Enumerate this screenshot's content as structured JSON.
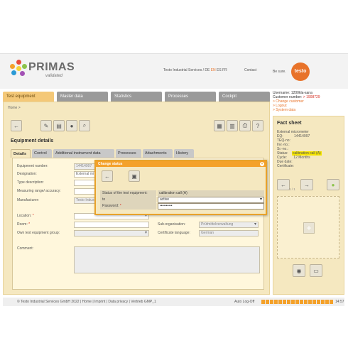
{
  "header": {
    "logo_text": "PRIMAS",
    "logo_sub": "validated",
    "company": "Testo Industrial Services / ",
    "languages": [
      "DE",
      "EN",
      "ES",
      "FR"
    ],
    "active_language": "EN",
    "contact": "Contact",
    "besure": "Be sure.",
    "testo": "testo"
  },
  "nav": {
    "tabs": [
      "Test equipment",
      "Master data",
      "Statistics",
      "Processes",
      "Cockpit"
    ],
    "active_tab": "Test equipment"
  },
  "user": {
    "username_label": "Username: 1200kla-sana",
    "customer_label": "Customer number: ",
    "customer_number": "> 1908729",
    "change_customer": "> Change customer",
    "logout": "> Logout",
    "system_data": "> System data"
  },
  "breadcrumb": "Home >",
  "page": {
    "title": "Equipment details",
    "subtabs": [
      "Details",
      "Control",
      "Additional instrument data",
      "Processes",
      "Attachments",
      "History"
    ],
    "active_subtab": "Details"
  },
  "form": {
    "equipment_number_label": "Equipment number:",
    "equipment_number_value": "14414997",
    "designation_label": "Designation:",
    "designation_value": "External mi",
    "type_description_label": "Type description:",
    "measuring_range_label": "Measuring range/ accuracy:",
    "manufacturer_label": "Manufacturer:",
    "manufacturer_value": "Testo Indust",
    "location_label": "Location:",
    "room_label": "Room:",
    "own_group_label": "Own test equipment group:",
    "suborg_label": "Sub-organisation:",
    "suborg_value": "Prüfmittelverwaltung",
    "cert_lang_label": "Certificate language:",
    "cert_lang_value": "German",
    "comment_label": "Comment:"
  },
  "fact_sheet": {
    "title": "Fact sheet",
    "rows": [
      {
        "label": "External micrometer",
        "value": ""
      },
      {
        "label": "EQ:",
        "value": "14414997"
      },
      {
        "label": "TEQ-no:",
        "value": ""
      },
      {
        "label": "Inv.-no.:",
        "value": ""
      },
      {
        "label": "Sr.-no.:",
        "value": ""
      },
      {
        "label": "Status:",
        "value": "calibration call (A)"
      },
      {
        "label": "Cycle:",
        "value": "12 Months"
      },
      {
        "label": "Due date:",
        "value": ""
      },
      {
        "label": "Certificate:",
        "value": ""
      }
    ],
    "pager": "1 / 1"
  },
  "modal": {
    "title": "Change status",
    "status_label": "Status of the test equipment:",
    "status_value": "calibration call (A)",
    "to_label": "to",
    "to_value": "active",
    "password_label": "Password:",
    "password_value": "••••••••••"
  },
  "footer": {
    "copyright": "© Testo Industrial Services GmbH 2022 | Home | Imprint | Data privacy | Vertrieb GMP_1",
    "autolog": "Auto Log-Off",
    "time": "14:57",
    "timer_fraction": 1.0
  },
  "colors": {
    "accent": "#e8732a",
    "tab_active": "#f4c878",
    "panel": "#f5e8c0",
    "modal_border": "#e8a22a"
  },
  "icons": [
    "back-arrow-icon",
    "edit-icon",
    "document-icon",
    "bulb-icon",
    "search-icon",
    "calculator-icon",
    "clipboard-icon",
    "print-icon",
    "help-icon",
    "save-icon",
    "camera-icon",
    "image-icon",
    "close-icon"
  ]
}
